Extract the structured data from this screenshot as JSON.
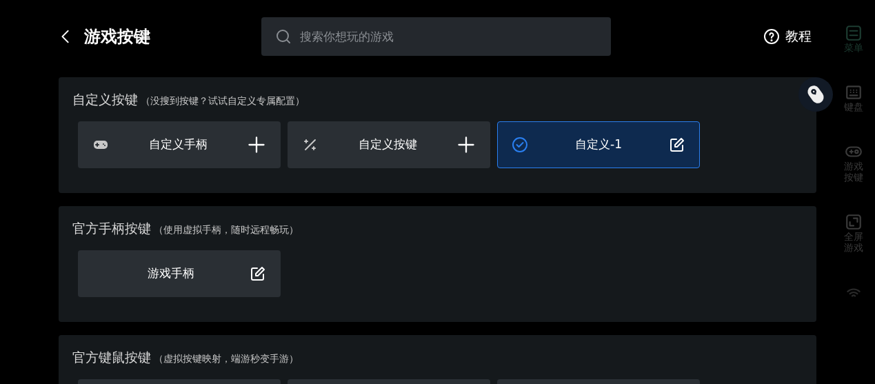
{
  "header": {
    "title": "游戏按键",
    "search": {
      "placeholder": "搜索你想玩的游戏"
    },
    "help_label": "教程"
  },
  "sections": [
    {
      "title": "自定义按键",
      "hint": "（没搜到按键？试试自定义专属配置）",
      "tiles": [
        {
          "kind": "add",
          "label": "自定义手柄",
          "selected": false
        },
        {
          "kind": "add",
          "label": "自定义按键",
          "selected": false
        },
        {
          "kind": "edit",
          "label": "自定义-1",
          "selected": true
        }
      ]
    },
    {
      "title": "官方手柄按键",
      "hint": "（使用虚拟手柄，随时远程畅玩）",
      "tiles": [
        {
          "kind": "edit",
          "label": "游戏手柄",
          "selected": false
        }
      ]
    },
    {
      "title": "官方键鼠按键",
      "hint": "（虚拟按键映射，端游秒变手游）",
      "tiles": [
        {
          "kind": "blank"
        },
        {
          "kind": "blank"
        },
        {
          "kind": "blank"
        }
      ]
    }
  ],
  "sidebar": {
    "items": [
      {
        "label": "菜单",
        "selected": true
      },
      {
        "label": "键盘",
        "selected": false
      },
      {
        "label": "游戏按键",
        "selected": false
      },
      {
        "label": "全屏游戏",
        "selected": false
      },
      {
        "kind": "signal"
      }
    ]
  }
}
